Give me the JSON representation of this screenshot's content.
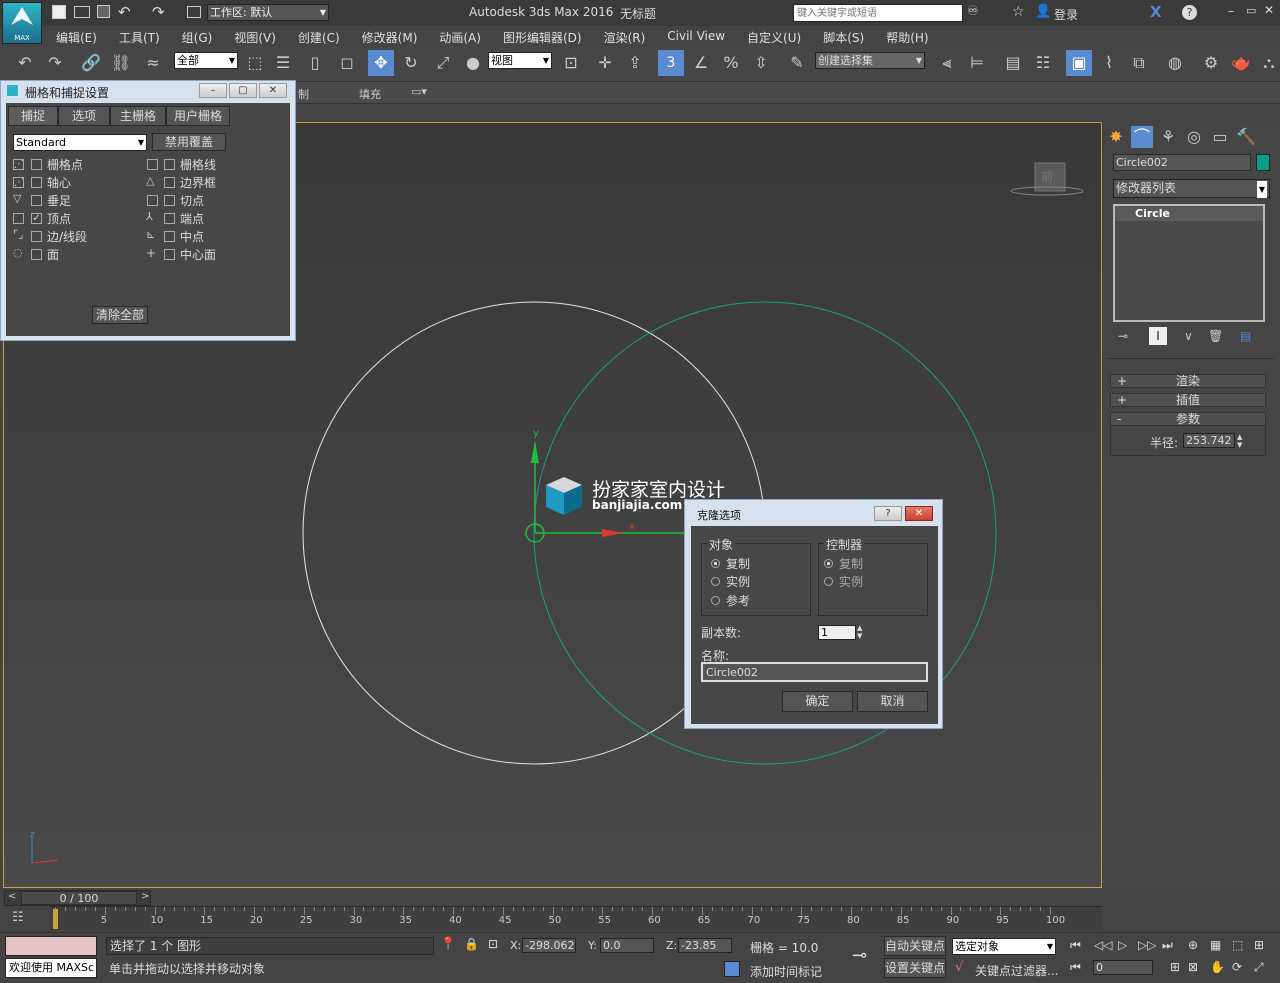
{
  "app": {
    "title": "Autodesk 3ds Max 2016",
    "doc_title": "无标题",
    "logo_label": "MAX",
    "workspace": "工作区: 默认",
    "search_placeholder": "键入关键字或短语",
    "login": "登录"
  },
  "menu": [
    "编辑(E)",
    "工具(T)",
    "组(G)",
    "视图(V)",
    "创建(C)",
    "修改器(M)",
    "动画(A)",
    "图形编辑器(D)",
    "渲染(R)",
    "Civil View",
    "自定义(U)",
    "脚本(S)",
    "帮助(H)"
  ],
  "toolbar": {
    "selection_filter": "全部",
    "ref_coord": "视图",
    "named_selection": "创建选择集",
    "snap_label": "3"
  },
  "ribbon2": {
    "tab_a": "制",
    "tab_b": "填充"
  },
  "grid_snap_dialog": {
    "title": "栅格和捕捉设置",
    "tabs": [
      "捕捉",
      "选项",
      "主栅格",
      "用户栅格"
    ],
    "preset": "Standard",
    "override_btn": "禁用覆盖",
    "left_items": [
      {
        "label": "栅格点",
        "checked": false
      },
      {
        "label": "轴心",
        "checked": false
      },
      {
        "label": "垂足",
        "checked": false
      },
      {
        "label": "顶点",
        "checked": true
      },
      {
        "label": "边/线段",
        "checked": false
      },
      {
        "label": "面",
        "checked": false
      }
    ],
    "right_items": [
      {
        "label": "栅格线",
        "checked": false
      },
      {
        "label": "边界框",
        "checked": false
      },
      {
        "label": "切点",
        "checked": false
      },
      {
        "label": "端点",
        "checked": false
      },
      {
        "label": "中点",
        "checked": false
      },
      {
        "label": "中心面",
        "checked": false
      }
    ],
    "clear_btn": "清除全部"
  },
  "viewport": {
    "view_cube_label": "前",
    "watermark_cn": "扮家家室内设计",
    "watermark_url": "banjiajia.com",
    "axis_x": "x",
    "axis_y": "y",
    "axis_z": "z"
  },
  "clone_dialog": {
    "title": "克隆选项",
    "help_btn": "?",
    "close_btn": "✕",
    "object_group": "对象",
    "object_options": [
      "复制",
      "实例",
      "参考"
    ],
    "object_selected": 0,
    "controller_group": "控制器",
    "controller_options": [
      "复制",
      "实例"
    ],
    "controller_selected": 0,
    "copies_label": "副本数:",
    "copies_value": "1",
    "name_label": "名称:",
    "name_value": "Circle002",
    "ok_btn": "确定",
    "cancel_btn": "取消"
  },
  "command_panel": {
    "object_name": "Circle002",
    "object_color": "#0a9e87",
    "modifier_list": "修改器列表",
    "stack_item": "Circle",
    "rollouts": [
      {
        "sign": "+",
        "label": "渲染"
      },
      {
        "sign": "+",
        "label": "插值"
      },
      {
        "sign": "-",
        "label": "参数"
      }
    ],
    "radius_label": "半径:",
    "radius_value": "253.742"
  },
  "timeline": {
    "frame_display": "0 / 100",
    "ticks": [
      "5",
      "10",
      "15",
      "20",
      "25",
      "30",
      "35",
      "40",
      "45",
      "50",
      "55",
      "60",
      "65",
      "70",
      "75",
      "80",
      "85",
      "90",
      "95",
      "100"
    ]
  },
  "status": {
    "welcome": "欢迎使用 MAXSc",
    "selection_info": "选择了 1 个 图形",
    "prompt": "单击并拖动以选择并移动对象",
    "x_label": "X:",
    "x_value": "-298.062",
    "y_label": "Y:",
    "y_value": "0.0",
    "z_label": "Z:",
    "z_value": "-23.85",
    "grid_info": "栅格 = 10.0",
    "add_time_tag": "添加时间标记",
    "auto_key": "自动关键点",
    "set_key": "设置关键点",
    "key_mode": "选定对象",
    "key_filters": "关键点过滤器...",
    "frame_value": "0"
  },
  "colors": {
    "accent": "#5a8bd0",
    "selected_circle": "#1a9e88",
    "white_circle": "#e8e8e8",
    "viewport_border": "#c8a23a"
  }
}
